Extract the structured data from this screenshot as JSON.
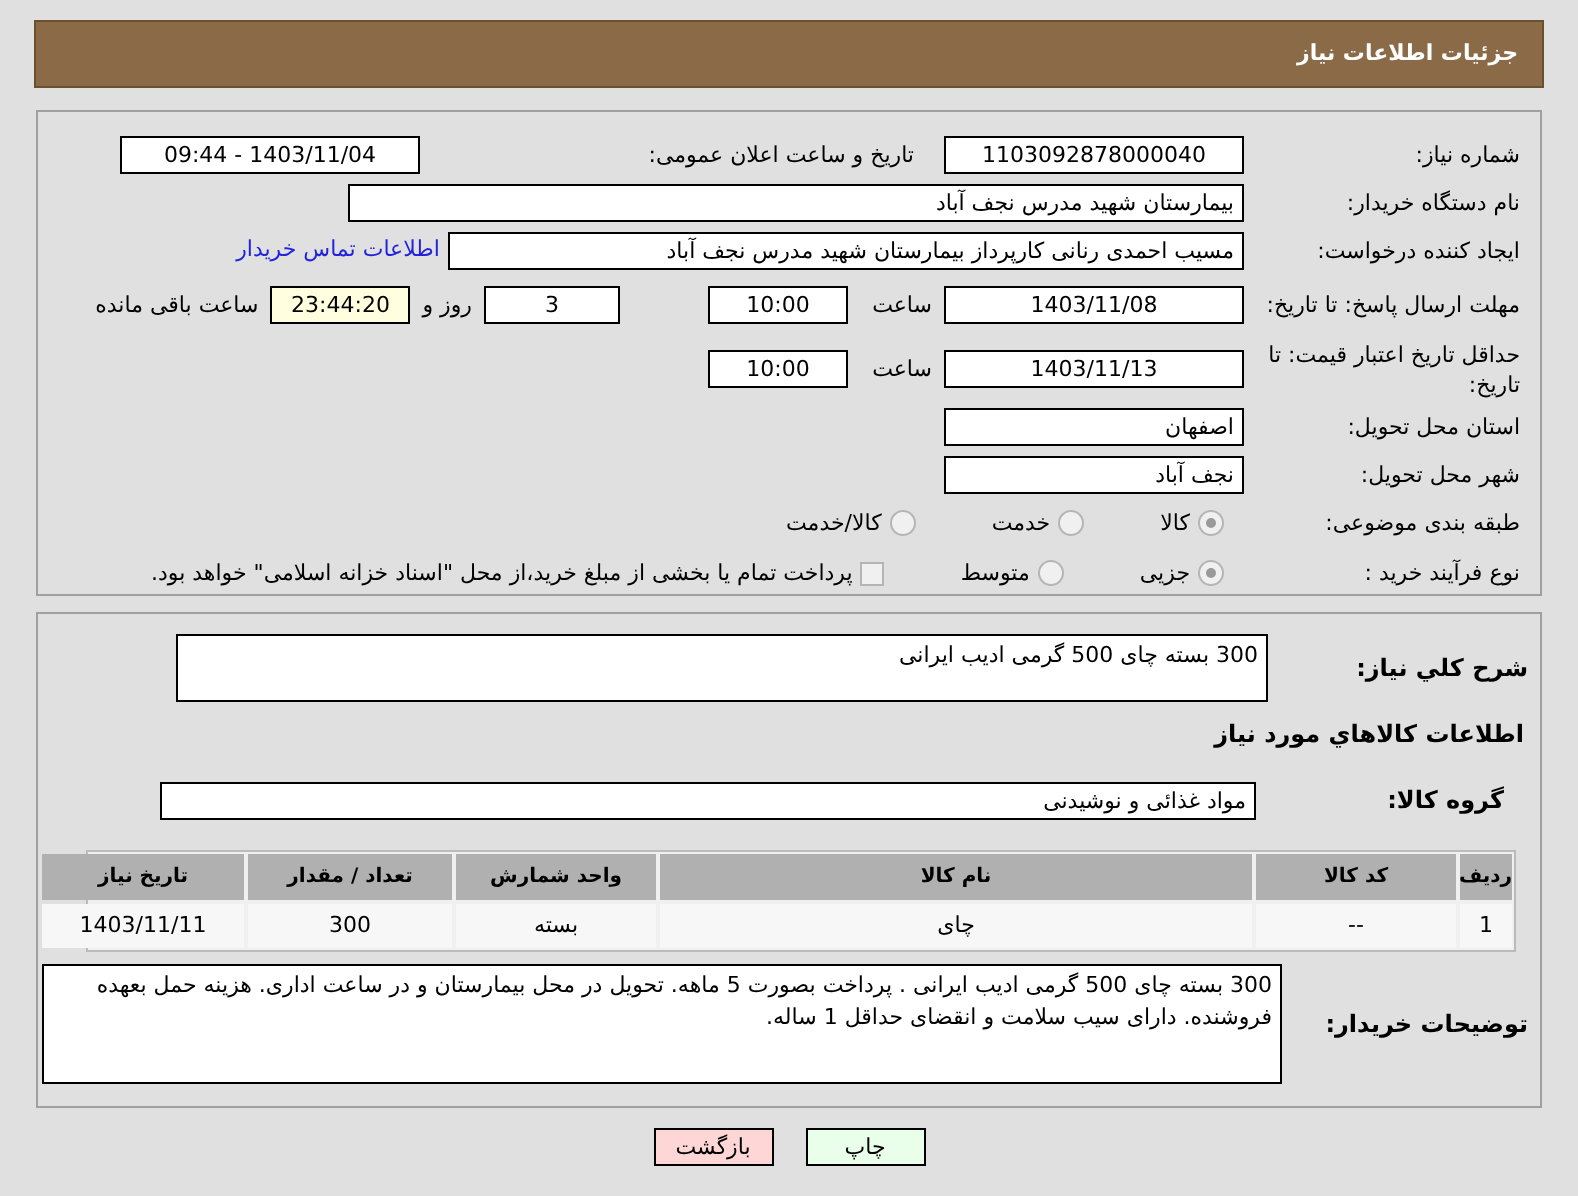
{
  "header": {
    "title": "جزئیات اطلاعات نیاز"
  },
  "details": {
    "need_number": {
      "label": "شماره نیاز:",
      "value": "1103092878000040"
    },
    "announce": {
      "label": "تاریخ و ساعت اعلان عمومی:",
      "value": "1403/11/04 - 09:44"
    },
    "buyer_org": {
      "label": "نام دستگاه خریدار:",
      "value": "بیمارستان شهید مدرس نجف آباد"
    },
    "creator": {
      "label": "ایجاد کننده درخواست:",
      "value": "مسیب احمدی رنانی کارپرداز بیمارستان شهید مدرس نجف آباد",
      "link": "اطلاعات تماس خریدار"
    },
    "deadline": {
      "label": "مهلت ارسال پاسخ: تا تاریخ:",
      "date": "1403/11/08",
      "time_label": "ساعت",
      "time": "10:00",
      "days": "3",
      "days_label": "روز و",
      "remaining": "23:44:20",
      "remaining_label": "ساعت باقی مانده"
    },
    "validity": {
      "label": "حداقل تاریخ اعتبار قیمت: تا تاریخ:",
      "date": "1403/11/13",
      "time_label": "ساعت",
      "time": "10:00"
    },
    "province": {
      "label": "استان محل تحویل:",
      "value": "اصفهان"
    },
    "city": {
      "label": "شهر محل تحویل:",
      "value": "نجف آباد"
    },
    "category": {
      "label": "طبقه بندی موضوعی:",
      "options": [
        {
          "label": "کالا",
          "selected": true
        },
        {
          "label": "خدمت",
          "selected": false
        },
        {
          "label": "کالا/خدمت",
          "selected": false
        }
      ]
    },
    "process": {
      "label": "نوع فرآیند خرید :",
      "options": [
        {
          "label": "جزیی",
          "selected": true
        },
        {
          "label": "متوسط",
          "selected": false
        }
      ],
      "treasury": {
        "label": "پرداخت تمام یا بخشی از مبلغ خرید،از محل \"اسناد خزانه اسلامی\" خواهد بود.",
        "checked": false
      }
    }
  },
  "goods": {
    "summary": {
      "label": "شرح کلي نياز:",
      "value": "300 بسته چای 500 گرمی ادیب ایرانی"
    },
    "heading": "اطلاعات کالاهاي مورد نياز",
    "group": {
      "label": "گروه کالا:",
      "value": "مواد غذائی و نوشیدنی"
    },
    "table": {
      "columns": [
        "ردیف",
        "کد کالا",
        "نام کالا",
        "واحد شمارش",
        "تعداد / مقدار",
        "تاریخ نیاز"
      ],
      "rows": [
        [
          "1",
          "--",
          "چای",
          "بسته",
          "300",
          "1403/11/11"
        ]
      ]
    },
    "notes": {
      "label": "توضیحات خریدار:",
      "value": "300 بسته چای 500 گرمی ادیب ایرانی . پرداخت بصورت 5 ماهه. تحویل در محل بیمارستان و در ساعت اداری. هزینه حمل بعهده فروشنده. دارای سیب سلامت و انقضای حداقل 1 ساله."
    }
  },
  "buttons": [
    {
      "label": "چاپ",
      "kind": "print"
    },
    {
      "label": "بازگشت",
      "kind": "back"
    }
  ]
}
